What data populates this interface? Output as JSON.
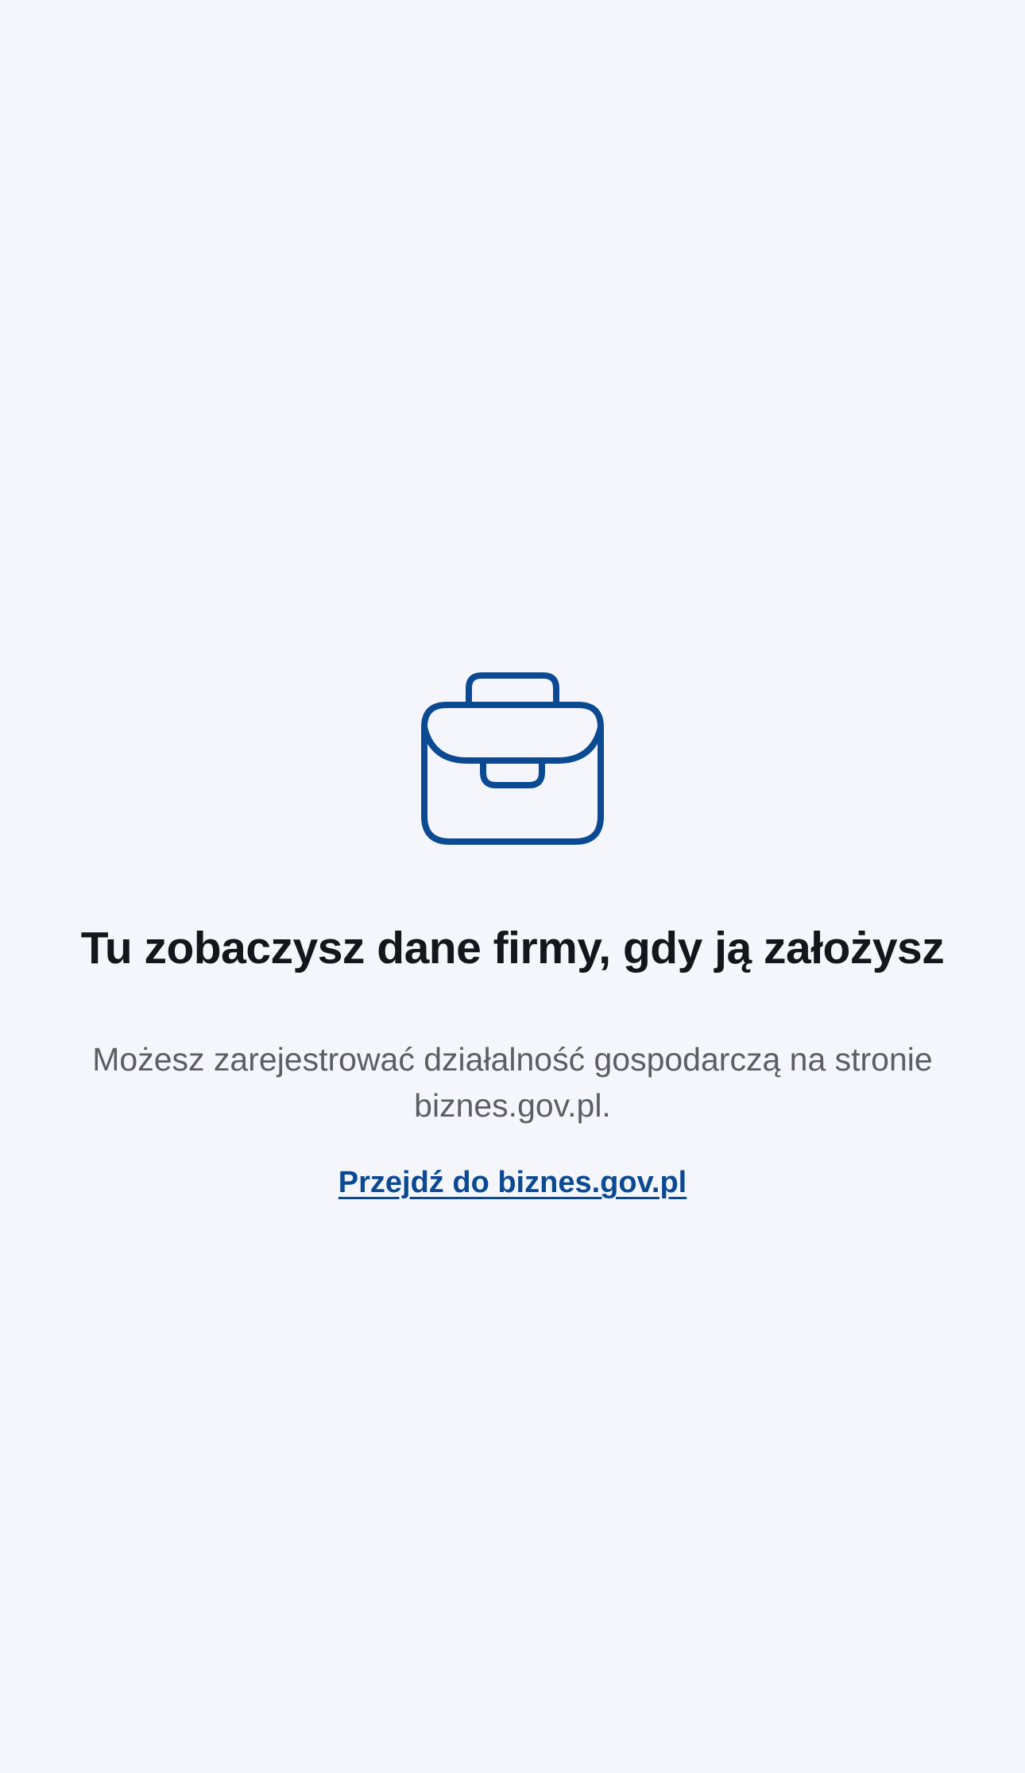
{
  "empty_state": {
    "icon": "briefcase-icon",
    "title": "Tu zobaczysz dane firmy, gdy ją założysz",
    "description": "Możesz zarejestrować działalność gospodarczą na stronie biznes.gov.pl.",
    "link_label": "Przejdź do biznes.gov.pl"
  },
  "colors": {
    "background": "#f4f6fb",
    "accent": "#0b4a93",
    "title_text": "#14161b",
    "body_text": "#5a5e66"
  }
}
